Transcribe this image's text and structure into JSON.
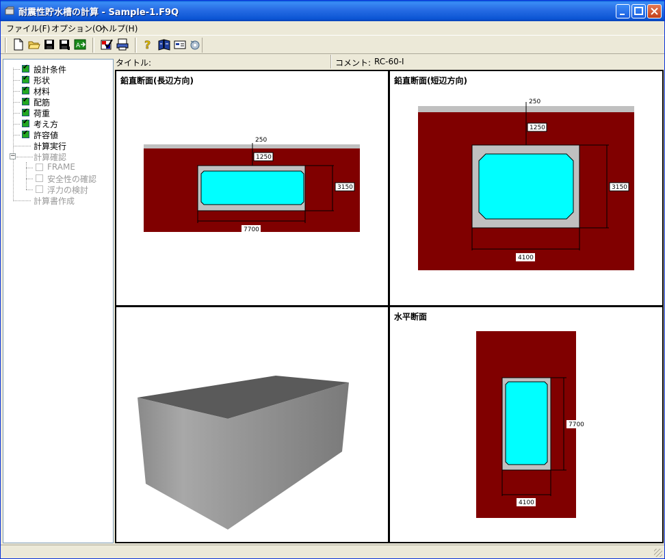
{
  "window": {
    "title": "耐震性貯水槽の計算 - Sample-1.F9Q"
  },
  "menu": {
    "items": [
      "ファイル(F)",
      "オプション(O)",
      "ヘルプ(H)"
    ]
  },
  "info": {
    "title_label": "タイトル:",
    "comment_label": "コメント:",
    "comment_value": "RC-60-I"
  },
  "tree": {
    "items": [
      {
        "label": "設計条件",
        "checked": true
      },
      {
        "label": "形状",
        "checked": true
      },
      {
        "label": "材料",
        "checked": true
      },
      {
        "label": "配筋",
        "checked": true
      },
      {
        "label": "荷重",
        "checked": true
      },
      {
        "label": "考え方",
        "checked": true
      },
      {
        "label": "許容値",
        "checked": true
      },
      {
        "label": "計算実行"
      },
      {
        "label": "計算確認",
        "expander": "−"
      },
      {
        "label": "FRAME"
      },
      {
        "label": "安全性の確認"
      },
      {
        "label": "浮力の検討"
      },
      {
        "label": "計算書作成"
      }
    ]
  },
  "panels": {
    "long": {
      "title": "鉛直断面(長辺方向)",
      "dims": {
        "top": "250",
        "cover": "1250",
        "height": "3150",
        "width": "7700"
      }
    },
    "short": {
      "title": "鉛直断面(短辺方向)",
      "dims": {
        "top": "250",
        "cover": "1250",
        "height": "3150",
        "width": "4100"
      }
    },
    "plan": {
      "title": "水平断面",
      "dims": {
        "length": "7700",
        "width": "4100"
      }
    }
  },
  "colors": {
    "soil": "#800000",
    "concrete": "#c0c0c0",
    "water": "#00ffff",
    "ground": "#c0c0c0"
  }
}
